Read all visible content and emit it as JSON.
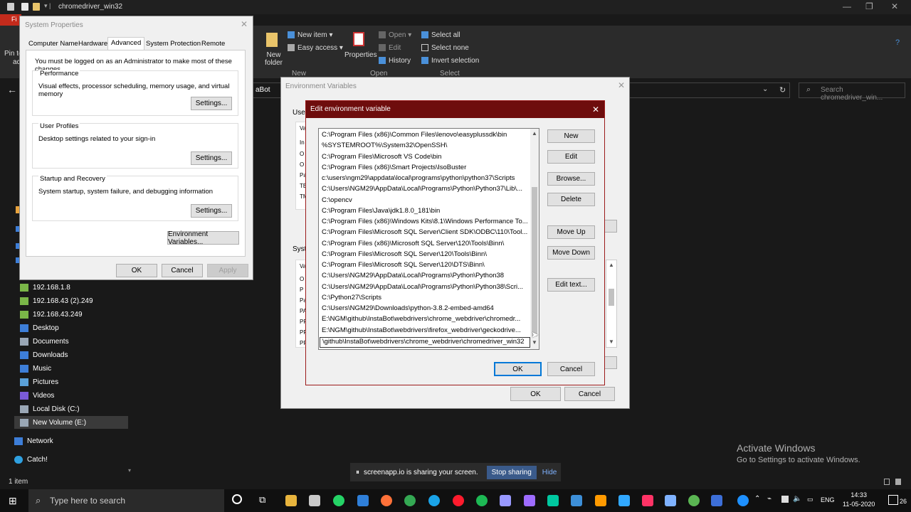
{
  "explorer": {
    "title": "chromedriver_win32",
    "file_tab": "Fi",
    "pin_label_1": "Pin to",
    "pin_label_2": "ac",
    "ribbon": {
      "new_folder_1": "New",
      "new_folder_2": "folder",
      "new_item": "New item ▾",
      "easy_access": "Easy access ▾",
      "properties": "Properties",
      "open": "Open ▾",
      "edit": "Edit",
      "history": "History",
      "select_all": "Select all",
      "select_none": "Select none",
      "invert_selection": "Invert selection",
      "group_new": "New",
      "group_open": "Open",
      "group_select": "Select"
    },
    "address_fragment": "aBot",
    "search_placeholder": "Search chromedriver_win...",
    "nav_items": [
      "192.168.1.8",
      "192.168.43 (2).249",
      "192.168.43.249",
      "Desktop",
      "Documents",
      "Downloads",
      "Music",
      "Pictures",
      "Videos",
      "Local Disk (C:)",
      "New Volume (E:)",
      "Network",
      "Catch!"
    ],
    "status": "1 item"
  },
  "sysprop": {
    "title": "System Properties",
    "tabs": [
      "Computer Name",
      "Hardware",
      "Advanced",
      "System Protection",
      "Remote"
    ],
    "admin_note": "You must be logged on as an Administrator to make most of these changes.",
    "performance_title": "Performance",
    "performance_desc": "Visual effects, processor scheduling, memory usage, and virtual memory",
    "profiles_title": "User Profiles",
    "profiles_desc": "Desktop settings related to your sign-in",
    "startup_title": "Startup and Recovery",
    "startup_desc": "System startup, system failure, and debugging information",
    "settings": "Settings...",
    "env_vars": "Environment Variables...",
    "ok": "OK",
    "cancel": "Cancel",
    "apply": "Apply"
  },
  "envvars": {
    "title": "Environment Variables",
    "user_label": "User",
    "system_label": "Syste",
    "user_cols": [
      "Va",
      "In",
      "O",
      "O",
      "Pa",
      "TE",
      "TM"
    ],
    "sys_cols": [
      "Va",
      "O",
      "P",
      "Pa",
      "PA",
      "PR",
      "PR",
      "PR"
    ],
    "ok": "OK",
    "cancel": "Cancel"
  },
  "editdlg": {
    "title": "Edit environment variable",
    "entries": [
      "C:\\Program Files (x86)\\Common Files\\lenovo\\easyplussdk\\bin",
      "%SYSTEMROOT%\\System32\\OpenSSH\\",
      "C:\\Program Files\\Microsoft VS Code\\bin",
      "C:\\Program Files (x86)\\Smart Projects\\IsoBuster",
      "c:\\users\\ngm29\\appdata\\local\\programs\\python\\python37\\Scripts",
      "C:\\Users\\NGM29\\AppData\\Local\\Programs\\Python\\Python37\\Lib\\...",
      "C:\\opencv",
      "C:\\Program Files\\Java\\jdk1.8.0_181\\bin",
      "C:\\Program Files (x86)\\Windows Kits\\8.1\\Windows Performance To...",
      "C:\\Program Files\\Microsoft SQL Server\\Client SDK\\ODBC\\110\\Tool...",
      "C:\\Program Files (x86)\\Microsoft SQL Server\\120\\Tools\\Binn\\",
      "C:\\Program Files\\Microsoft SQL Server\\120\\Tools\\Binn\\",
      "C:\\Program Files\\Microsoft SQL Server\\120\\DTS\\Binn\\",
      "C:\\Users\\NGM29\\AppData\\Local\\Programs\\Python\\Python38",
      "C:\\Users\\NGM29\\AppData\\Local\\Programs\\Python\\Python38\\Scri...",
      "C:\\Python27\\Scripts",
      "C:\\Users\\NGM29\\Downloads\\python-3.8.2-embed-amd64",
      "E:\\NGM\\github\\InstaBot\\webdrivers\\chrome_webdriver\\chromedr...",
      "E:\\NGM\\github\\InstaBot\\webdrivers\\firefox_webdriver\\geckodrive...",
      "\\github\\InstaBot\\webdrivers\\chrome_webdriver\\chromedriver_win32"
    ],
    "buttons": [
      "New",
      "Edit",
      "Browse...",
      "Delete",
      "Move Up",
      "Move Down",
      "Edit text..."
    ],
    "ok": "OK",
    "cancel": "Cancel"
  },
  "share_bar": {
    "message": "screenapp.io is sharing your screen.",
    "stop": "Stop sharing",
    "hide": "Hide"
  },
  "activate": {
    "title": "Activate Windows",
    "sub": "Go to Settings to activate Windows."
  },
  "taskbar": {
    "search": "Type here to search",
    "lang": "ENG",
    "time": "14:33",
    "date": "11-05-2020",
    "notif_count": "26"
  }
}
